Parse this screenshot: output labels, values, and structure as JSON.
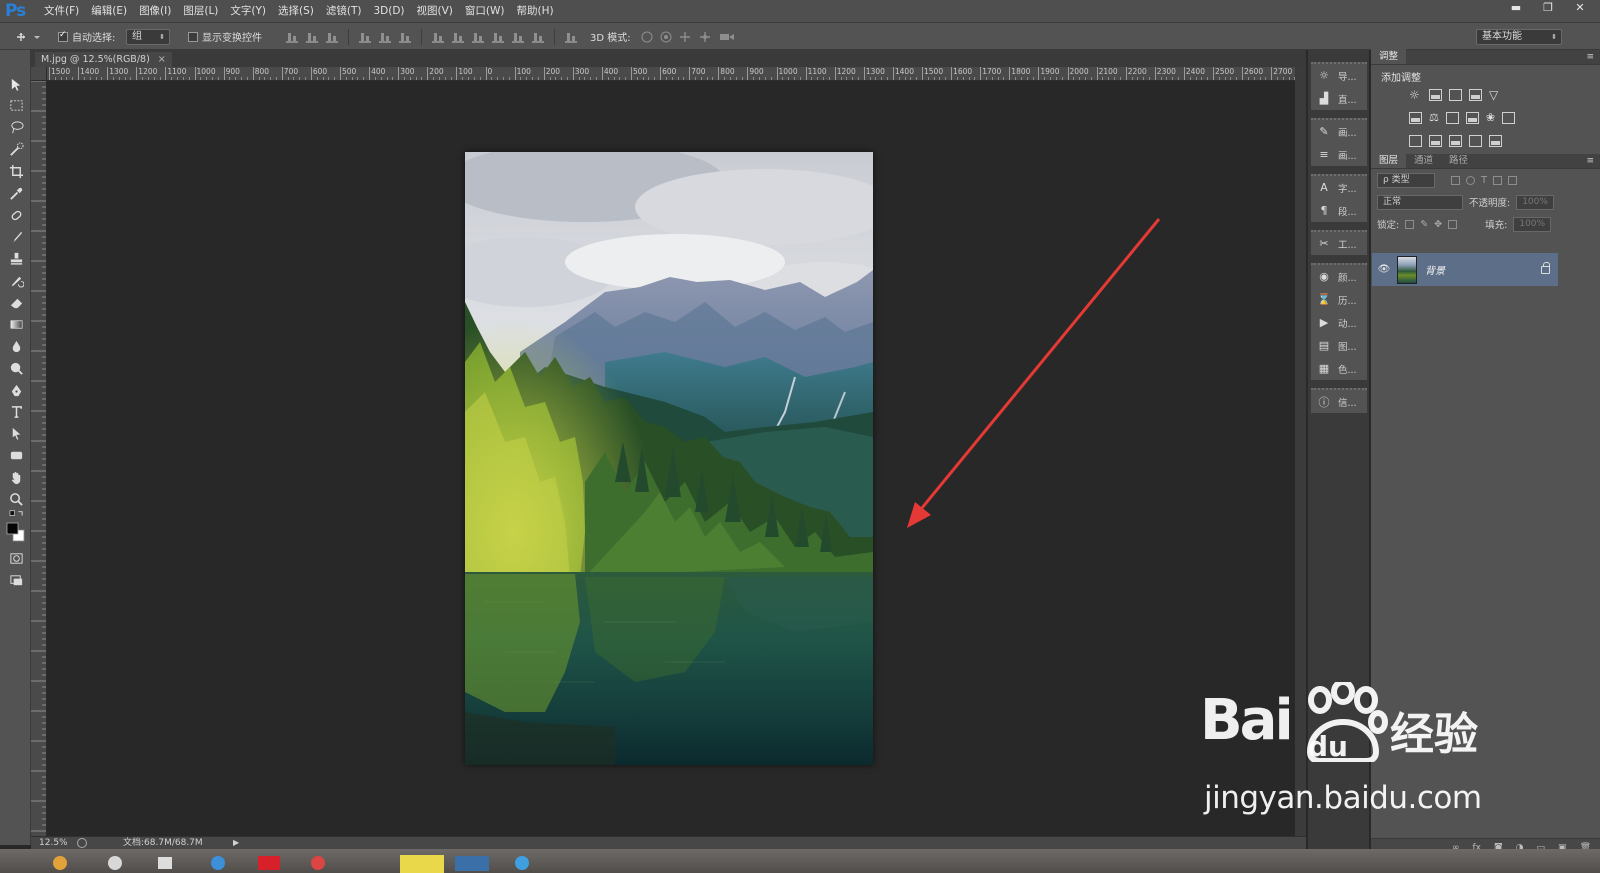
{
  "app": {
    "logo": "Ps"
  },
  "menubar": {
    "items": [
      "文件(F)",
      "编辑(E)",
      "图像(I)",
      "图层(L)",
      "文字(Y)",
      "选择(S)",
      "滤镜(T)",
      "3D(D)",
      "视图(V)",
      "窗口(W)",
      "帮助(H)"
    ]
  },
  "window_controls": {
    "minimize": "▬",
    "restore": "❐",
    "close": "✕"
  },
  "options": {
    "auto_select_label": "自动选择:",
    "auto_select_checked": true,
    "auto_select_value": "组",
    "show_transform_label": "显示变换控件",
    "show_transform_checked": false,
    "mode_3d_label": "3D 模式:",
    "workspace": "基本功能"
  },
  "document": {
    "tab_title": "M.jpg @ 12.5%(RGB/8)",
    "close": "×"
  },
  "ruler": {
    "h_ticks": [
      "1500",
      "1400",
      "1300",
      "1200",
      "1100",
      "1000",
      "900",
      "800",
      "700",
      "600",
      "500",
      "400",
      "300",
      "200",
      "100",
      "0",
      "100",
      "200",
      "300",
      "400",
      "500",
      "600",
      "700",
      "800",
      "900",
      "1000",
      "1100",
      "1200",
      "1300",
      "1400",
      "1500",
      "1600",
      "1700",
      "1800",
      "1900",
      "2000",
      "2100",
      "2200",
      "2300",
      "2400",
      "2500",
      "2600",
      "2700",
      "280"
    ]
  },
  "status": {
    "zoom": "12.5%",
    "doc_size": "文档:68.7M/68.7M",
    "arrow": "▶"
  },
  "dock": {
    "groups": [
      {
        "items": [
          {
            "icon": "navigator-icon",
            "glyph": "☼",
            "label": "导..."
          },
          {
            "icon": "histogram-icon",
            "glyph": "▟",
            "label": "直..."
          }
        ]
      },
      {
        "items": [
          {
            "icon": "brush-preset-icon",
            "glyph": "✎",
            "label": "画..."
          },
          {
            "icon": "brush-icon",
            "glyph": "≡",
            "label": "画..."
          }
        ]
      },
      {
        "items": [
          {
            "icon": "character-icon",
            "glyph": "A",
            "label": "字..."
          },
          {
            "icon": "paragraph-icon",
            "glyph": "¶",
            "label": "段..."
          }
        ]
      },
      {
        "items": [
          {
            "icon": "tool-presets-icon",
            "glyph": "✂",
            "label": "工..."
          }
        ]
      },
      {
        "items": [
          {
            "icon": "color-icon",
            "glyph": "◉",
            "label": "颜..."
          },
          {
            "icon": "history-icon",
            "glyph": "⌛",
            "label": "历..."
          },
          {
            "icon": "actions-icon",
            "glyph": "▶",
            "label": "动..."
          },
          {
            "icon": "layer-comps-icon",
            "glyph": "▤",
            "label": "图..."
          },
          {
            "icon": "clone-source-icon",
            "glyph": "▦",
            "label": "色..."
          }
        ]
      },
      {
        "items": [
          {
            "icon": "info-icon",
            "glyph": "ⓘ",
            "label": "信..."
          }
        ]
      }
    ]
  },
  "adjustments": {
    "tab": "调整",
    "title": "添加调整"
  },
  "layers": {
    "tabs": [
      "图层",
      "通道",
      "路径"
    ],
    "filter_label": "ρ 类型",
    "blend_mode": "正常",
    "opacity_label": "不透明度:",
    "opacity_value": "100%",
    "lock_label": "锁定:",
    "fill_label": "填充:",
    "fill_value": "100%",
    "layer_name": "背景",
    "footer_icons": [
      "∞",
      "fx",
      "◙",
      "◑",
      "▭",
      "▣",
      "🗑"
    ]
  },
  "watermark": {
    "brand": "Bai",
    "du": "du",
    "jingyan": "经验",
    "url": "jingyan.baidu.com"
  },
  "colors": {
    "accent": "#2a7fd6",
    "annotation_arrow": "#e53935",
    "layer_selected": "#5d6f88"
  }
}
